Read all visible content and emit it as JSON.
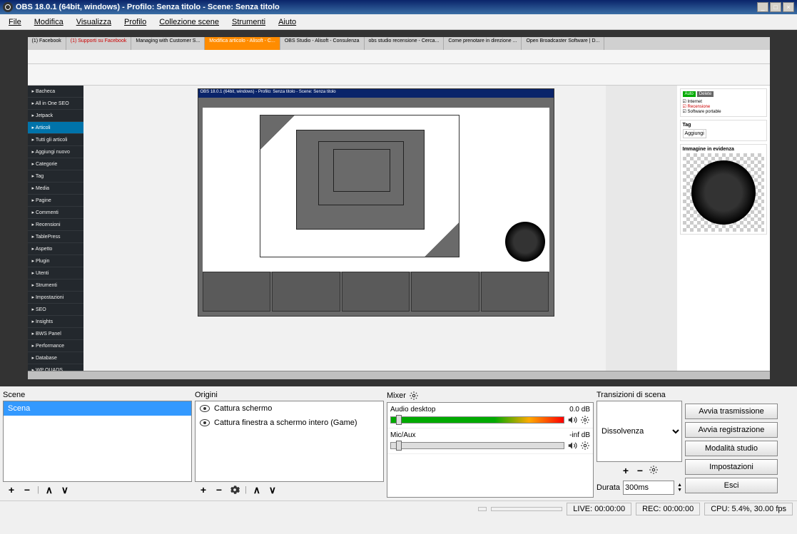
{
  "titlebar": {
    "text": "OBS 18.0.1 (64bit, windows) - Profilo: Senza titolo - Scene: Senza titolo"
  },
  "menubar": [
    "File",
    "Modifica",
    "Visualizza",
    "Profilo",
    "Collezione scene",
    "Strumenti",
    "Aiuto"
  ],
  "panels": {
    "scene": {
      "title": "Scene",
      "items": [
        "Scena"
      ],
      "selected": 0
    },
    "sources": {
      "title": "Origini",
      "items": [
        "Cattura schermo",
        "Cattura finestra a schermo intero (Game)"
      ]
    },
    "mixer": {
      "title": "Mixer",
      "channels": [
        {
          "name": "Audio desktop",
          "level": "0.0 dB",
          "thumb": 3
        },
        {
          "name": "Mic/Aux",
          "level": "-inf dB",
          "thumb": 3
        }
      ]
    },
    "transitions": {
      "title": "Transizioni di scena",
      "selected": "Dissolvenza",
      "duration_label": "Durata",
      "duration_value": "300ms"
    },
    "buttons": [
      "Avvia trasmissione",
      "Avvia registrazione",
      "Modalità studio",
      "Impostazioni",
      "Esci"
    ]
  },
  "statusbar": {
    "live": "LIVE: 00:00:00",
    "rec": "REC: 00:00:00",
    "cpu": "CPU: 5.4%, 30.00 fps"
  },
  "preview": {
    "browser_tabs": [
      "(1) Facebook",
      "(1) Supporti su Facebook",
      "Managing with Customer S...",
      "Modifica articolo - Alisoft - C...",
      "OBS Studio - Alisoft - Consulenza",
      "obs studio recensione - Cerca...",
      "Come prenotare in direzione ...",
      "Open Broadcaster Software | D..."
    ],
    "wp_sidebar": [
      "Bacheca",
      "All in One SEO",
      "Jetpack",
      "Articoli",
      "Tutti gli articoli",
      "Aggiungi nuovo",
      "Categorie",
      "Tag",
      "Media",
      "Pagine",
      "Commenti",
      "Recensioni",
      "TablePress",
      "Aspetto",
      "Plugin",
      "Utenti",
      "Strumenti",
      "Impostazioni",
      "SEO",
      "Insights",
      "BWS Panel",
      "Performance",
      "Database",
      "WP QUADS"
    ],
    "wp_active": 3,
    "right_badges": [
      "Internet",
      "Recensione",
      "Software portable"
    ],
    "tag_title": "Tag",
    "tag_btn": "Aggiungi",
    "featured_title": "Immagine in evidenza"
  }
}
